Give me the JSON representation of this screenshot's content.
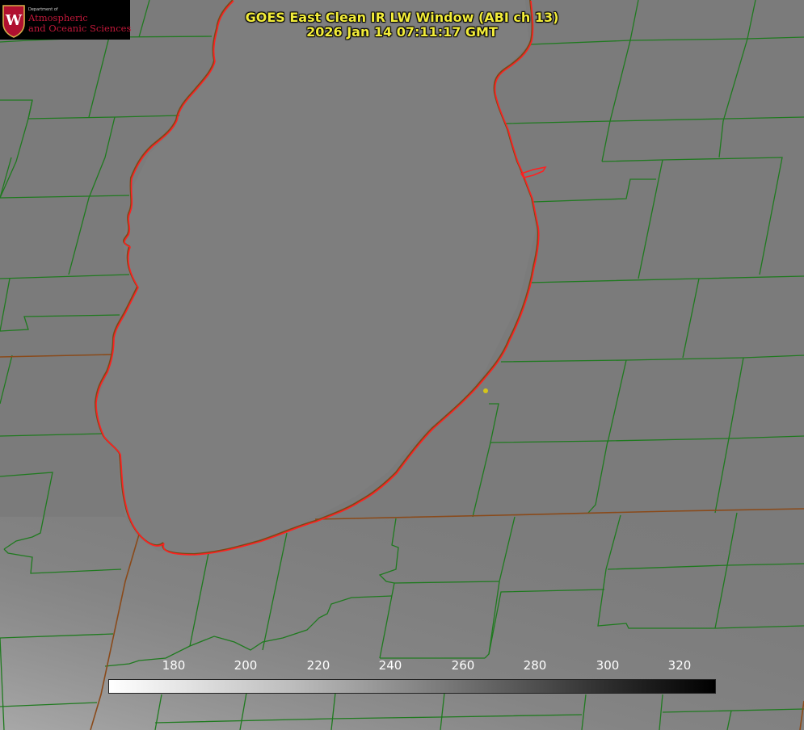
{
  "title": {
    "line1": "GOES East Clean IR LW Window (ABI ch 13)",
    "line2": "2026 Jan 14 07:11:17 GMT"
  },
  "logo": {
    "department": "Department of",
    "line1": "Atmospheric",
    "line2": "and Oceanic Sciences",
    "crest_letter": "W"
  },
  "colorbar": {
    "ticks": [
      "180",
      "200",
      "220",
      "240",
      "260",
      "280",
      "300",
      "320"
    ]
  },
  "colors": {
    "background": "#7a7a7a",
    "county_lines": "#1f7a1f",
    "lake_outline": "#ff2020",
    "state_border": "#8a4a1a",
    "title_text": "#f2ec3a",
    "logo_text": "#c2183a"
  }
}
